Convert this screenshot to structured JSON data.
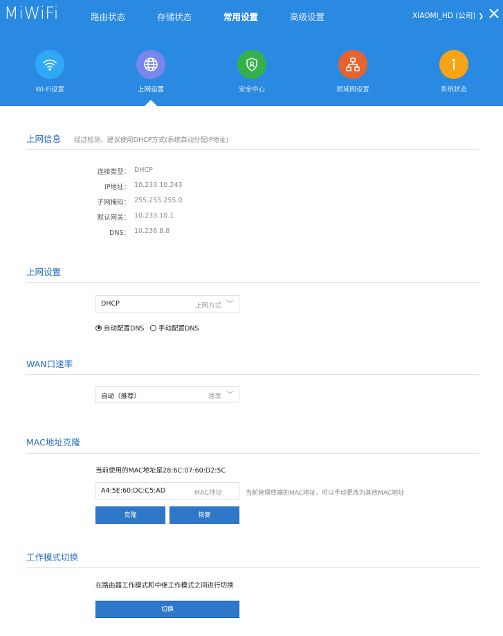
{
  "header": {
    "logo": "MiWiFi",
    "nav": [
      "路由状态",
      "存储状态",
      "常用设置",
      "高级设置"
    ],
    "active_nav": "常用设置",
    "account": "XIAOMI_HD (公司)",
    "close_glyph": "×"
  },
  "subnav": [
    {
      "label": "Wi-Fi设置",
      "icon": "wifi-icon",
      "color": "#2fa9f5"
    },
    {
      "label": "上网设置",
      "icon": "globe-icon",
      "color": "#7a86ec"
    },
    {
      "label": "安全中心",
      "icon": "shield-icon",
      "color": "#34b14a"
    },
    {
      "label": "局域网设置",
      "icon": "network-icon",
      "color": "#e8622d"
    },
    {
      "label": "系统状态",
      "icon": "info-icon",
      "color": "#f6a316"
    }
  ],
  "internet_info": {
    "title": "上网信息",
    "subtitle": "经过检测，建议使用DHCP方式(系统自动分配IP地址)",
    "rows": [
      {
        "label": "连接类型：",
        "value": "DHCP"
      },
      {
        "label": "IP地址：",
        "value": "10.233.10.243"
      },
      {
        "label": "子网掩码：",
        "value": "255.255.255.0"
      },
      {
        "label": "默认网关：",
        "value": "10.233.10.1"
      },
      {
        "label": "DNS：",
        "value": "10.236.8.8"
      }
    ]
  },
  "internet_settings": {
    "title": "上网设置",
    "select_value": "DHCP",
    "select_hint": "上网方式",
    "dns_auto": "自动配置DNS",
    "dns_manual": "手动配置DNS"
  },
  "wan_speed": {
    "title": "WAN口速率",
    "select_value": "自动（推荐）",
    "select_hint": "速率"
  },
  "mac_clone": {
    "title": "MAC地址克隆",
    "current_text": "当前使用的MAC地址是28:6C:07:60:D2:5C",
    "input_value": "A4:5E:60:DC:C5:AD",
    "input_hint": "MAC地址",
    "input_note": "当前管理终端的MAC地址，可以手动更改为其他MAC地址",
    "clone_button": "克隆",
    "restore_button": "恢复"
  },
  "mode_switch": {
    "title": "工作模式切换",
    "description": "在路由器工作模式和中继工作模式之间进行切换",
    "switch_button": "切换"
  },
  "colors": {
    "header_bg": "#2a8ae2",
    "title_blue": "#2a6fbf",
    "button_blue": "#2d78c8"
  }
}
